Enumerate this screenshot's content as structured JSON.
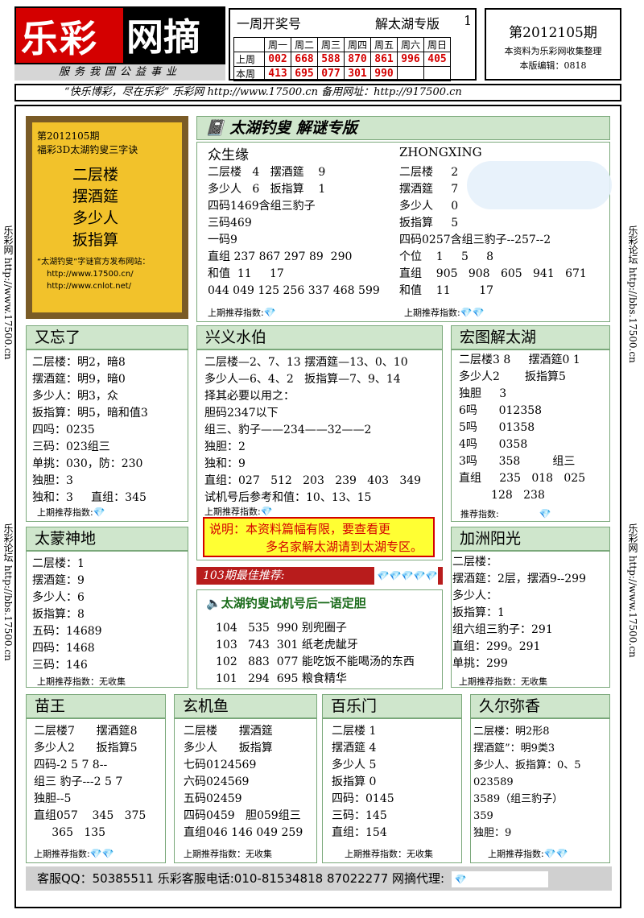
{
  "logo": {
    "left": "乐彩",
    "right": "网摘"
  },
  "slogan": "服务我国公益事业",
  "header": {
    "week": "一周开奖号",
    "special": "解太湖专版",
    "page": "1"
  },
  "draw": {
    "days": [
      "周一",
      "周二",
      "周三",
      "周四",
      "周五",
      "周六",
      "周日"
    ],
    "last_label": "上周",
    "last": [
      "002",
      "668",
      "588",
      "870",
      "861",
      "996",
      "405"
    ],
    "this_label": "本周",
    "this": [
      "413",
      "695",
      "077",
      "301",
      "990",
      "",
      ""
    ]
  },
  "issue": {
    "no": "第2012105期",
    "src": "本资料为乐彩网收集整理",
    "editor": "本版编辑：0818"
  },
  "urlbar": "“快乐博彩，尽在乐彩”   乐彩网  http://www.17500.cn     备用网址：http://917500.cn",
  "side": {
    "left1": "乐彩网 http://www.17500.cn",
    "left2": "乐彩论坛 http://bbs.17500.cn",
    "right1": "乐彩论坛 http://bbs.17500.cn",
    "right2": "乐彩网 http://www.17500.cn"
  },
  "yellow": {
    "l1": "第2012105期",
    "l2": "福彩3D太湖钓叟三字诀",
    "poem": [
      "二层楼",
      "摆酒筵",
      "多少人",
      "扳指算"
    ],
    "s1": "“太湖钓叟”字谜官方发布网站：",
    "s2": "http://www.17500.cn/",
    "s3": "http://www.cnlot.net/"
  },
  "main_title": "太湖钓叟 解谜专版",
  "zhong": {
    "name": "众生缘",
    "lines": "二层楼   4   摆酒筵    9\n多少人   6   扳指算    1\n四码1469含组三豹子\n三码469\n一码9\n直组 237 867 297 89  290\n和值  11     17\n044 049 125 256 337 468 599",
    "idx": "上期推荐指数:"
  },
  "zx": {
    "name": "ZHONGXING",
    "lines": "二层楼     2\n摆酒筵     7\n多少人     0\n扳指算     5\n四码0257含组三豹子--257--2\n个位    1     5     8\n直组    905   908   605   941   671\n和值    11        17",
    "idx": "上期推荐指数:"
  },
  "p1": {
    "title": "又忘了",
    "lines": "二层楼：明2，暗8\n摆酒筵：明9，暗0\n多少人：明3，众\n扳指算：明5，暗和值3\n四吗：0235\n三码：023组三\n单挑：030，防：230\n独胆：3\n独和：3     直组：345",
    "idx": "上期推荐指数:"
  },
  "p2": {
    "title": "兴义水伯",
    "lines": "二层楼—2、7、13 摆酒筵—13、0、10\n多少人—6、4、2   扳指算—7、9、14\n择其必要以用之：\n胆码2347以下\n组三、豹子——234——32——2\n独胆：2\n独和：9\n直组：027   512   203   239   403   349\n试机号后参考和值：10、13、15",
    "idx": "上期推荐指数:"
  },
  "p3": {
    "title": "宏图解太湖",
    "lines": "二层楼3 8     摆酒筵0 1\n多少人2       扳指算5\n独胆     3\n6吗      012358\n5吗      01358\n4吗      0358\n3吗      358         组三\n直组     235   018   025\n         128   238",
    "idx": "推荐指数:"
  },
  "note": {
    "l1": "说明：本资料篇幅有限，要查看更",
    "l2": "多名家解太湖请到太湖专区。"
  },
  "p4": {
    "title": "太蒙神地",
    "lines": "二层楼：1\n摆酒筵：9\n多少人：6\n扳指算：8\n五码：14689\n四码：1468\n三码：146",
    "idx": "上期推荐指数：无收集"
  },
  "best": "103期最佳推荐:",
  "trial": {
    "title": "太湖钓叟试机号后一语定胆",
    "lines": "104   535  990 别兜圈子\n103   743  301 纸老虎龇牙\n102   883  077 能吃饭不能喝汤的东西\n101   294  695 粮食精华"
  },
  "p5": {
    "title": "加洲阳光",
    "lines": "二层楼：\n摆酒筵：2层，摆酒9--299\n多少人：\n扳指算：1\n组六组三豹子：291\n直组：299。291\n单挑：299",
    "idx": "上期推荐指数：无收集"
  },
  "p6": {
    "title": "苗王",
    "lines": "二层楼7      摆酒筵8\n多少人2      扳指算5\n四码-2 5 7 8--\n组三 豹子---2 5 7\n独胆--5\n直组057    345   375\n     365   135",
    "idx": "上期推荐指数:"
  },
  "p7": {
    "title": "玄机鱼",
    "lines": "二层楼      摆酒筵\n多少人      扳指算\n七码0124569\n六码024569\n五码02459\n四码0459   胆059组三\n直组046 146 049 259",
    "idx": "上期推荐指数：无收集"
  },
  "p8": {
    "title": "百乐门",
    "lines": "二层楼 1\n摆酒筵 4\n多少人 5\n扳指算 0\n四码：0145\n三码：145\n直组：154",
    "idx": "上期推荐指数：无收集"
  },
  "p9": {
    "title": "久尔弥香",
    "lines": "二层楼：明2形8\n摆酒筵”：明9类3\n多少人、扳指算：0、5\n023589\n3589（组三豹子）\n359\n独胆：9",
    "idx": "上期推荐指数:"
  },
  "footer": "客服QQ：50385511   乐彩客服电话:010-81534818  87022277   网摘代理:",
  "icons": {
    "diamond": "diamond-icon",
    "speaker": "speaker-icon",
    "notebook": "notebook-icon"
  },
  "colors": {
    "brand_red": "#d40000",
    "panel_green": "#cfe6cc",
    "note_yellow": "#ffff33"
  }
}
